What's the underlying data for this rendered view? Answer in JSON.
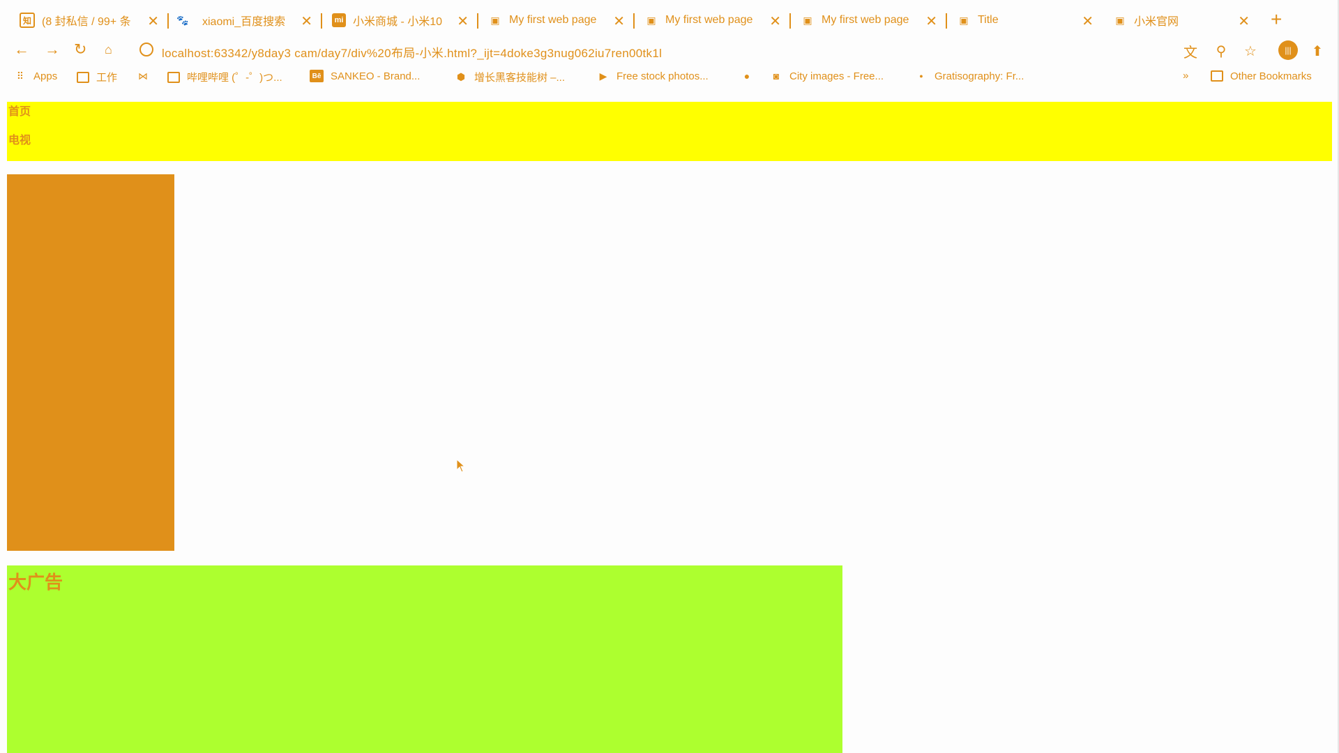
{
  "tabs": [
    {
      "label": "(8 封私信 / 99+ 条",
      "icon": "zhihu-icon"
    },
    {
      "label": "xiaomi_百度搜索",
      "icon": "baidu-paw-icon"
    },
    {
      "label": "小米商城 - 小米10",
      "icon": "mi-logo-icon"
    },
    {
      "label": "My first web page",
      "icon": "page-icon"
    },
    {
      "label": "My first web page",
      "icon": "page-icon"
    },
    {
      "label": "My first web page",
      "icon": "page-icon"
    },
    {
      "label": "Title",
      "icon": "page-icon"
    },
    {
      "label": "小米官网",
      "icon": "page-icon"
    }
  ],
  "toolbar": {
    "url": "localhost:63342/y8day3 cam/day7/div%20布局-小米.html?_ijt=4doke3g3nug062iu7ren00tk1l"
  },
  "bookmarks": {
    "items": [
      {
        "label": "Apps",
        "icon": "apps-grid-icon"
      },
      {
        "label": "工作",
        "icon": "folder-icon"
      },
      {
        "label": "",
        "icon": "bowtie-icon"
      },
      {
        "label": "哔哩哔哩 (゜-゜)つ...",
        "icon": "bilibili-icon"
      },
      {
        "label": "SANKEO - Brand...",
        "icon": "behance-icon"
      },
      {
        "label": "增长黑客技能树 –...",
        "icon": "hexagon-icon"
      },
      {
        "label": "Free stock photos...",
        "icon": "play-box-icon"
      },
      {
        "label": "",
        "icon": "globe-icon"
      },
      {
        "label": "City images - Free...",
        "icon": "camera-icon"
      },
      {
        "label": "Gratisography: Fr...",
        "icon": "dot-icon"
      }
    ],
    "overflow": "»",
    "other": "Other Bookmarks"
  },
  "page": {
    "nav": [
      "首页",
      "电视"
    ],
    "ad": "大广告"
  },
  "colors": {
    "accent": "#e0901a",
    "yellow": "#ffff00",
    "orange": "#e0901a",
    "green": "#adff2f"
  }
}
